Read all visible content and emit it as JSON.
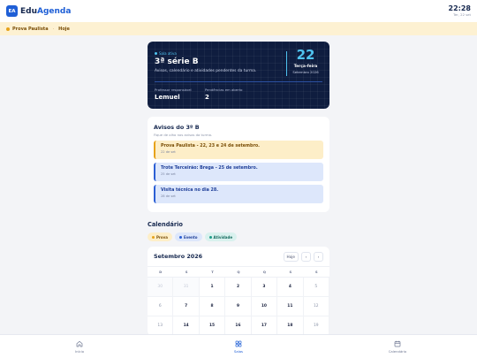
{
  "app": {
    "logo_text": "EA",
    "name_part1": "Edu",
    "name_part2": "Agenda",
    "time": "22:28",
    "date": "Ter, 22 set"
  },
  "banner": {
    "event": "Prova Paulista",
    "when": "Hoje"
  },
  "hero": {
    "tag": "Sala ativa",
    "class_name": "3ª série B",
    "subtitle": "Avisos, calendário e atividades pendentes da turma.",
    "day_number": "22",
    "weekday": "Terça-feira",
    "month_year": "Setembro 2026",
    "teacher_label": "Professor responsável",
    "teacher": "Lemuel",
    "pending_label": "Pendências em aberto",
    "pending": "2"
  },
  "notices": {
    "title": "Avisos do 3º B",
    "hint": "Fique de olho nos avisos da turma.",
    "items": [
      {
        "title": "Prova Paulista - 22, 23 e 24 de setembro.",
        "date": "22 de set",
        "kind": "prova"
      },
      {
        "title": "Trote Terceirão: Brega - 25 de setembro.",
        "date": "25 de set",
        "kind": "evento"
      },
      {
        "title": "Visita técnica no dia 28.",
        "date": "28 de set",
        "kind": "evento"
      }
    ]
  },
  "calendar": {
    "title": "Calendário",
    "legend": [
      "Prova",
      "Evento",
      "Atividade"
    ],
    "month": "Setembro 2026",
    "today_button": "Hoje",
    "prev_icon": "‹",
    "next_icon": "›",
    "weekdays": [
      "D",
      "S",
      "T",
      "Q",
      "Q",
      "S",
      "S"
    ],
    "days": [
      [
        "30",
        "31",
        "1",
        "2",
        "3",
        "4",
        "5"
      ],
      [
        "6",
        "7",
        "8",
        "9",
        "10",
        "11",
        "12"
      ],
      [
        "13",
        "14",
        "15",
        "16",
        "17",
        "18",
        "19"
      ]
    ]
  },
  "tabs": [
    {
      "label": "Início",
      "icon": "home-icon"
    },
    {
      "label": "Salas",
      "icon": "grid-icon"
    },
    {
      "label": "Calendário",
      "icon": "calendar-icon"
    }
  ]
}
